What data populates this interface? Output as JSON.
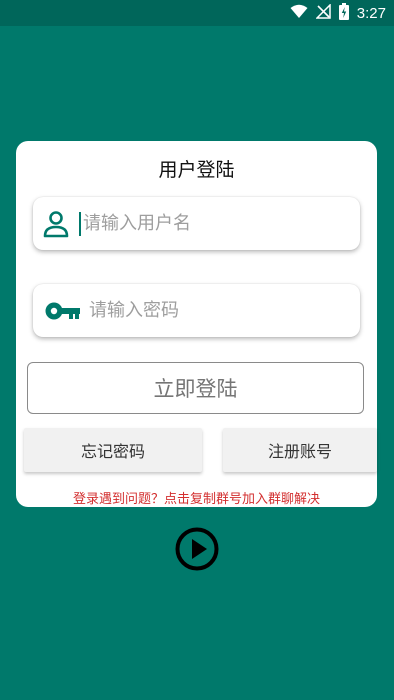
{
  "status_bar": {
    "time": "3:27",
    "icons": [
      "wifi-icon",
      "no-signal-icon",
      "battery-charging-icon"
    ]
  },
  "login_card": {
    "title": "用户登陆",
    "username": {
      "placeholder": "请输入用户名",
      "value": "",
      "icon": "user-icon"
    },
    "password": {
      "placeholder": "请输入密码",
      "value": "",
      "icon": "key-icon"
    },
    "login_button": "立即登陆",
    "forgot_password_button": "忘记密码",
    "register_button": "注册账号",
    "help_text": "登录遇到问题？点击复制群号加入群聊解决"
  },
  "play_button_icon": "play-circle-icon",
  "colors": {
    "background": "#00796b",
    "status_bar": "#00665a",
    "accent": "#00796b",
    "help_text": "#d32f2f"
  }
}
